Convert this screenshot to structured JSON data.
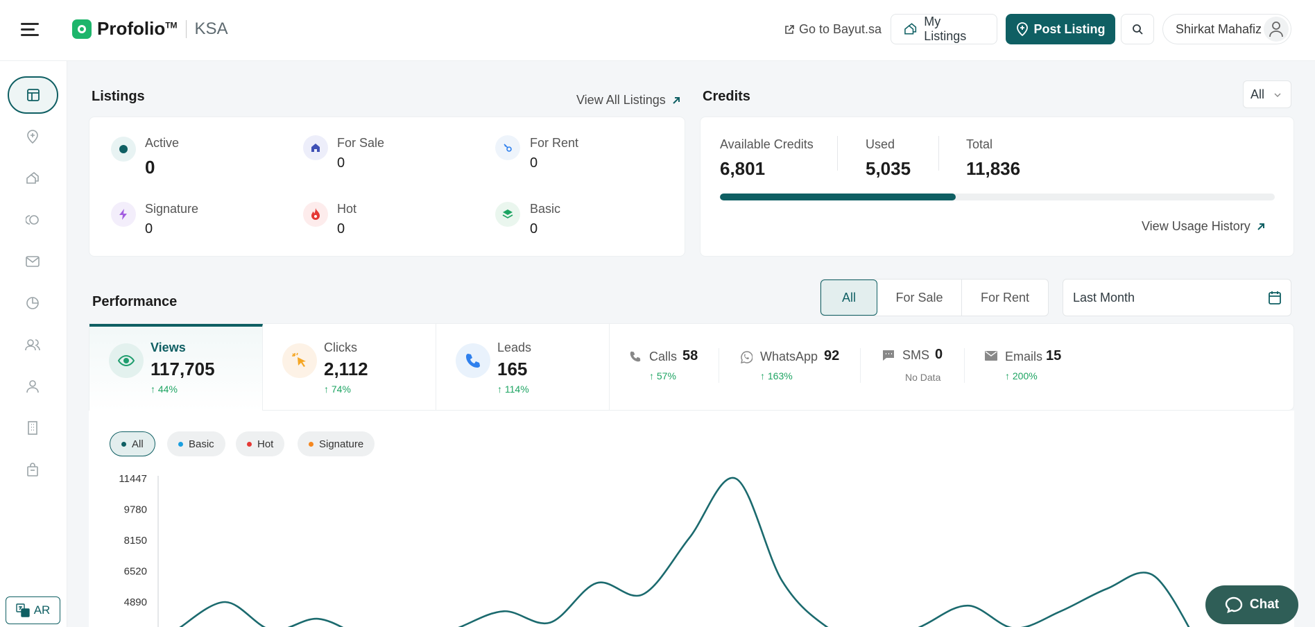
{
  "header": {
    "brand": "Profolio",
    "brand_tm": "TM",
    "region": "KSA",
    "goto_link": "Go to Bayut.sa",
    "my_listings": "My Listings",
    "post_listing": "Post Listing",
    "user_name": "Shirkat Mahafiz"
  },
  "sidebar": {
    "items": [
      "dashboard-icon",
      "add-location-icon",
      "listings-icon",
      "leads-icon",
      "mail-icon",
      "analytics-icon",
      "team-icon",
      "profile-icon",
      "building-icon",
      "bag-icon"
    ],
    "lang": "AR"
  },
  "listings": {
    "title": "Listings",
    "view_all": "View All Listings",
    "stats": [
      {
        "label": "Active",
        "value": "0"
      },
      {
        "label": "For Sale",
        "value": "0"
      },
      {
        "label": "For Rent",
        "value": "0"
      },
      {
        "label": "Signature",
        "value": "0"
      },
      {
        "label": "Hot",
        "value": "0"
      },
      {
        "label": "Basic",
        "value": "0"
      }
    ]
  },
  "credits": {
    "title": "Credits",
    "filter": "All",
    "available_label": "Available Credits",
    "available": "6,801",
    "used_label": "Used",
    "used": "5,035",
    "total_label": "Total",
    "total": "11,836",
    "used_fraction": 0.425,
    "usage_history": "View Usage History"
  },
  "performance": {
    "title": "Performance",
    "segments": [
      "All",
      "For Sale",
      "For Rent"
    ],
    "date_range": "Last Month",
    "metrics": [
      {
        "label": "Views",
        "value": "117,705",
        "change": "↑ 44%"
      },
      {
        "label": "Clicks",
        "value": "2,112",
        "change": "↑ 74%"
      },
      {
        "label": "Leads",
        "value": "165",
        "change": "↑ 114%"
      }
    ],
    "leads": [
      {
        "label": "Calls",
        "value": "58",
        "change": "↑ 57%"
      },
      {
        "label": "WhatsApp",
        "value": "92",
        "change": "↑ 163%"
      },
      {
        "label": "SMS",
        "value": "0",
        "change": "No Data"
      },
      {
        "label": "Emails",
        "value": "15",
        "change": "↑ 200%"
      }
    ],
    "chips": [
      "All",
      "Basic",
      "Hot",
      "Signature"
    ]
  },
  "chart_data": {
    "type": "line",
    "y_ticks": [
      "11447",
      "9780",
      "8150",
      "6520",
      "4890"
    ],
    "series": [
      {
        "values": [
          3500,
          4890,
          3400,
          4000,
          3000,
          2500,
          3500,
          4400,
          3800,
          5900,
          5300,
          8300,
          11447,
          6000,
          3500,
          2500,
          3600,
          4700,
          3500,
          4400,
          5600,
          6300,
          2500
        ]
      }
    ],
    "color": "#1b6a6e"
  },
  "chat_label": "Chat"
}
